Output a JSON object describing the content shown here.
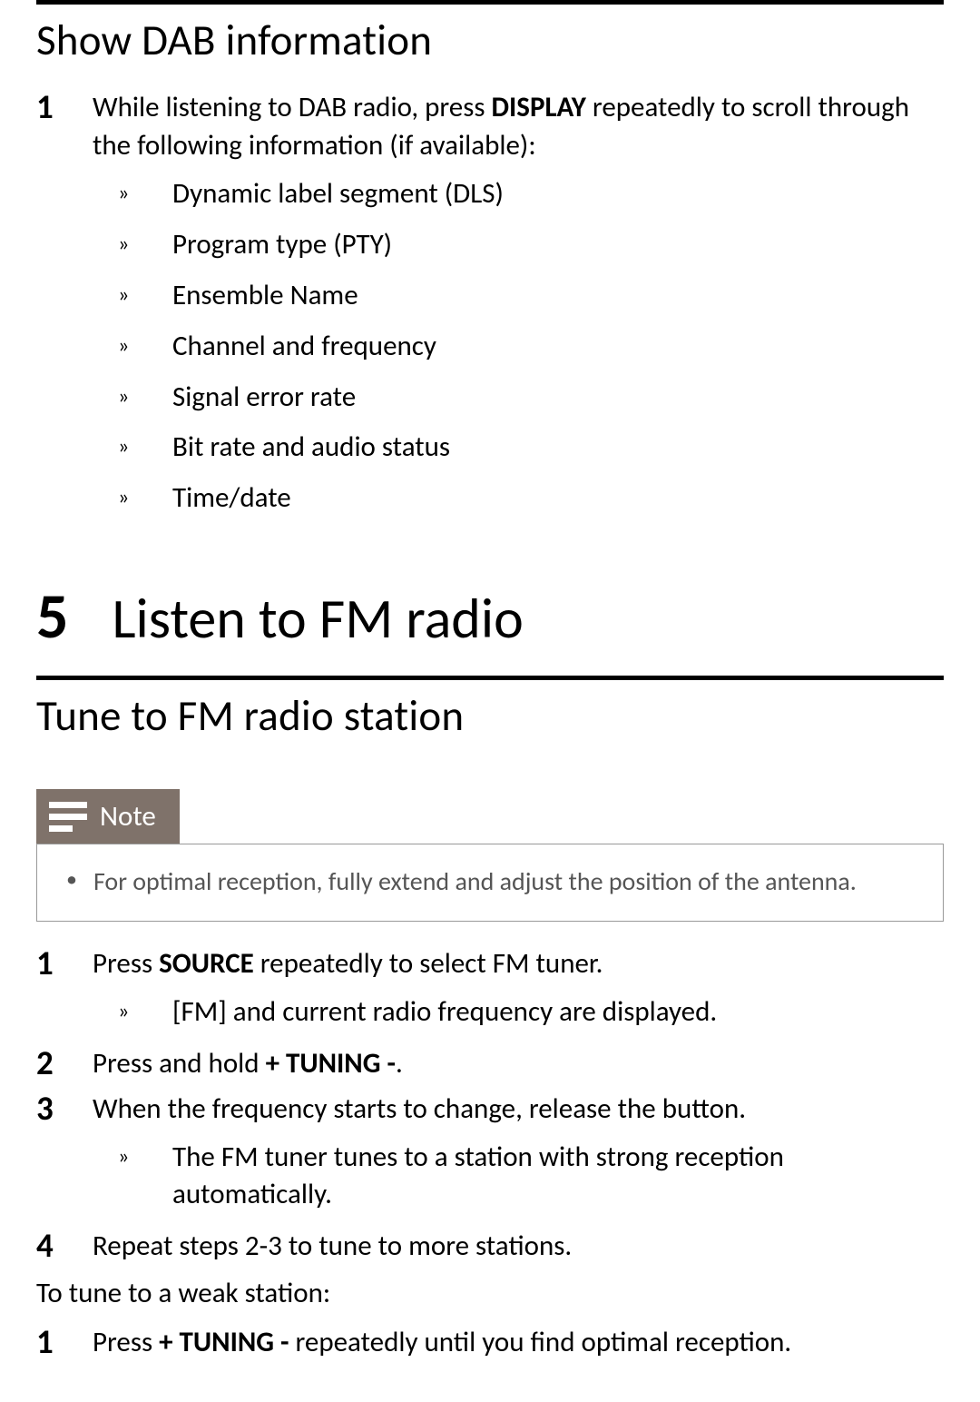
{
  "section1": {
    "heading": "Show DAB information",
    "step1": {
      "pre": "While listening to DAB radio, press ",
      "bold": "DISPLAY",
      "post": " repeatedly to scroll through the following information (if available):"
    },
    "bullets": [
      "Dynamic label segment (DLS)",
      "Program type (PTY)",
      "Ensemble Name",
      "Channel and frequency",
      "Signal error rate",
      "Bit rate and audio status",
      "Time/date"
    ]
  },
  "chapter": {
    "num": "5",
    "title": "Listen to FM radio"
  },
  "section2": {
    "heading": "Tune to FM radio station",
    "note": {
      "label": "Note",
      "items": [
        "For optimal reception, fully extend and adjust the position of the antenna."
      ]
    },
    "steps": {
      "s1": {
        "pre": "Press ",
        "bold": "SOURCE",
        "post": " repeatedly to select FM tuner.",
        "sub_bold": "[FM]",
        "sub_post": " and current radio frequency are displayed."
      },
      "s2": {
        "pre": "Press and hold ",
        "bold": "+ TUNING -",
        "post": "."
      },
      "s3": {
        "line": "When the frequency starts to change, release the button.",
        "sub": "The FM tuner tunes to a station with strong reception automatically."
      },
      "s4": {
        "line": "Repeat steps 2-3 to tune to more stations."
      }
    },
    "weak": {
      "heading": "To tune to a weak station:",
      "s1": {
        "pre": "Press ",
        "bold": "+ TUNING -",
        "post": " repeatedly until you find optimal reception."
      }
    }
  }
}
